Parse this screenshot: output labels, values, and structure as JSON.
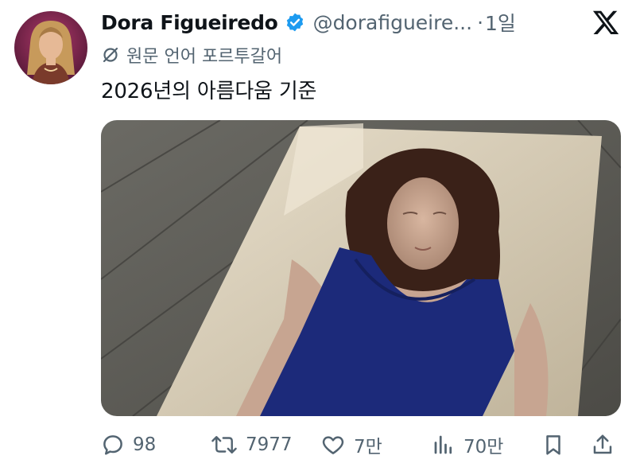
{
  "tweet": {
    "author_name": "Dora Figueiredo",
    "handle": "@dorafigueire...",
    "separator": "·",
    "time": "1일",
    "translation_note": "원문 언어 포르투갈어",
    "text": "2026년의 아름다움 기준"
  },
  "actions": {
    "replies": "98",
    "retweets": "7977",
    "likes": "7만",
    "views": "70만"
  },
  "icons": {
    "verified": "verified-badge-icon",
    "logo": "x-logo-icon",
    "translate": "translate-icon",
    "reply": "reply-icon",
    "retweet": "retweet-icon",
    "like": "heart-icon",
    "views": "views-icon",
    "bookmark": "bookmark-icon",
    "share": "share-icon"
  },
  "colors": {
    "text": "#0f1419",
    "secondary": "#536471",
    "verified": "#1d9bf0"
  }
}
